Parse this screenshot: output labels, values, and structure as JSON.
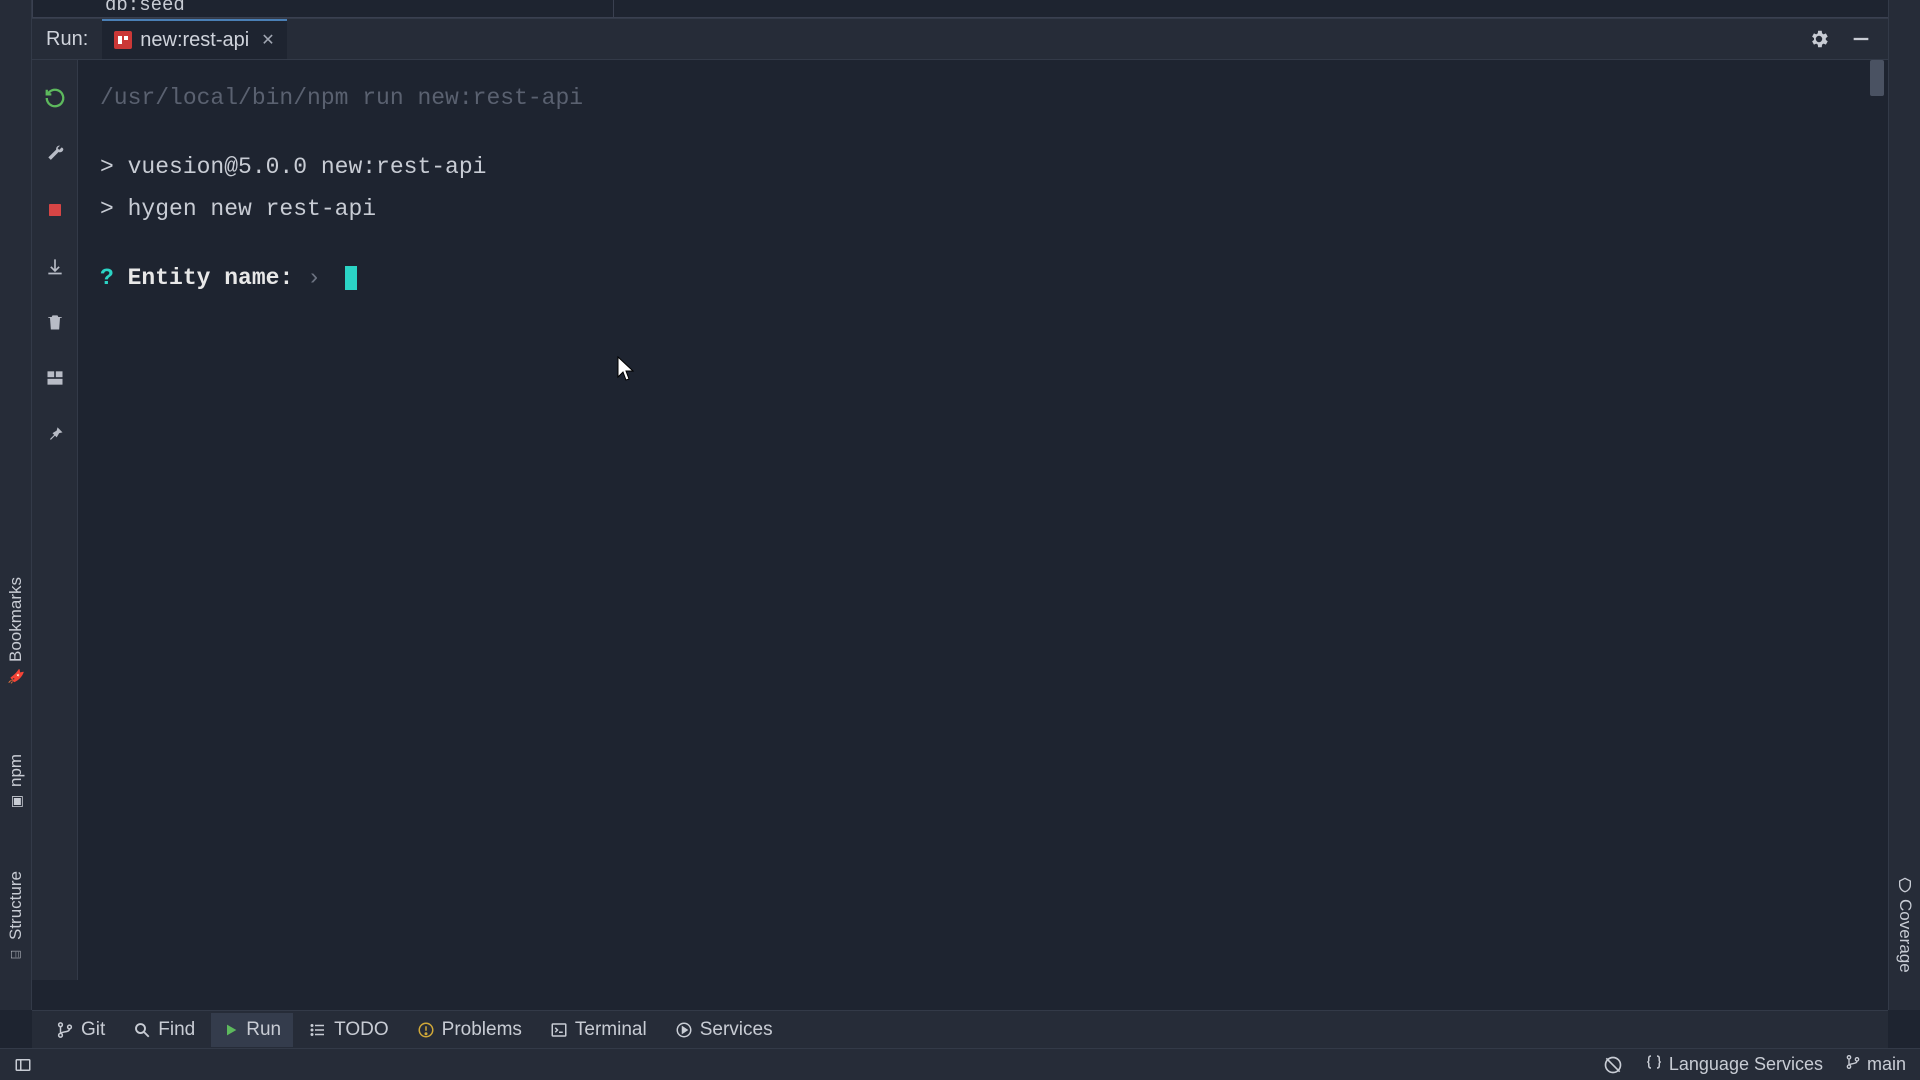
{
  "editor_peek_line": "db:seed",
  "run": {
    "label": "Run:",
    "tab": {
      "label": "new:rest-api"
    }
  },
  "left_rail": {
    "bookmarks": "Bookmarks",
    "npm": "npm",
    "structure": "Structure"
  },
  "right_rail": {
    "coverage": "Coverage"
  },
  "console": {
    "command": "/usr/local/bin/npm run new:rest-api",
    "lines": [
      "> vuesion@5.0.0 new:rest-api",
      "> hygen new rest-api"
    ],
    "prompt": {
      "marker": "?",
      "label": "Entity name:",
      "chevron": "›"
    }
  },
  "bottom_bar": {
    "git": "Git",
    "find": "Find",
    "run": "Run",
    "todo": "TODO",
    "problems": "Problems",
    "terminal": "Terminal",
    "services": "Services"
  },
  "status_bar": {
    "language_services": "Language Services",
    "branch": "main"
  },
  "colors": {
    "bg": "#1e2430",
    "panel": "#262c38",
    "accent_teal": "#2bd4c5",
    "accent_blue": "#4a7fb5",
    "npm_red": "#cb3837"
  }
}
